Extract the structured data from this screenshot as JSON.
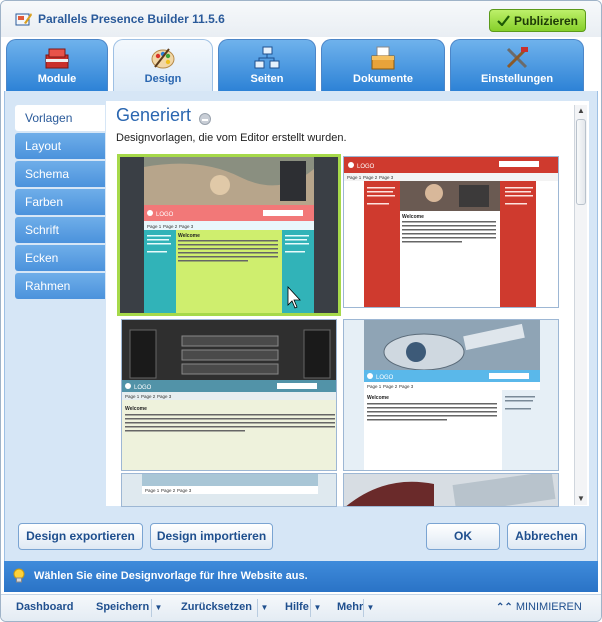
{
  "app": {
    "title": "Parallels Presence Builder 11.5.6",
    "publish_label": "Publizieren"
  },
  "tabs": [
    {
      "label": "Module"
    },
    {
      "label": "Design"
    },
    {
      "label": "Seiten"
    },
    {
      "label": "Dokumente"
    },
    {
      "label": "Einstellungen"
    }
  ],
  "sidebar": {
    "items": [
      {
        "label": "Vorlagen"
      },
      {
        "label": "Layout"
      },
      {
        "label": "Schema"
      },
      {
        "label": "Farben"
      },
      {
        "label": "Schrift"
      },
      {
        "label": "Ecken"
      },
      {
        "label": "Rahmen"
      }
    ]
  },
  "panel": {
    "title": "Generiert",
    "description": "Designvorlagen, die vom Editor erstellt wurden."
  },
  "templates": {
    "logo_text": "LOGO",
    "nav": [
      "Page 1",
      "Page 2",
      "Page 3"
    ],
    "welcome": "Welcome",
    "sidebar_text": "Lorem ipsum dolor sit amet, consectetur adipiscing elit.",
    "sidebar_text2": "Sed suscipit pretium justo."
  },
  "buttons": {
    "export": "Design exportieren",
    "import": "Design importieren",
    "ok": "OK",
    "cancel": "Abbrechen"
  },
  "hint": "Wählen Sie eine Designvorlage für Ihre Website aus.",
  "footer": {
    "dashboard": "Dashboard",
    "save": "Speichern",
    "reset": "Zurücksetzen",
    "help": "Hilfe",
    "more": "Mehr",
    "minimize": "MINIMIEREN"
  },
  "colors": {
    "accent_blue": "#2d82d6",
    "publish_green": "#86cf2a",
    "selected_border": "#a6d94a",
    "template_pink": "#f27878",
    "template_teal": "#31b3b8",
    "template_red": "#cf3a2e",
    "template_cyan": "#5ab8ea"
  }
}
